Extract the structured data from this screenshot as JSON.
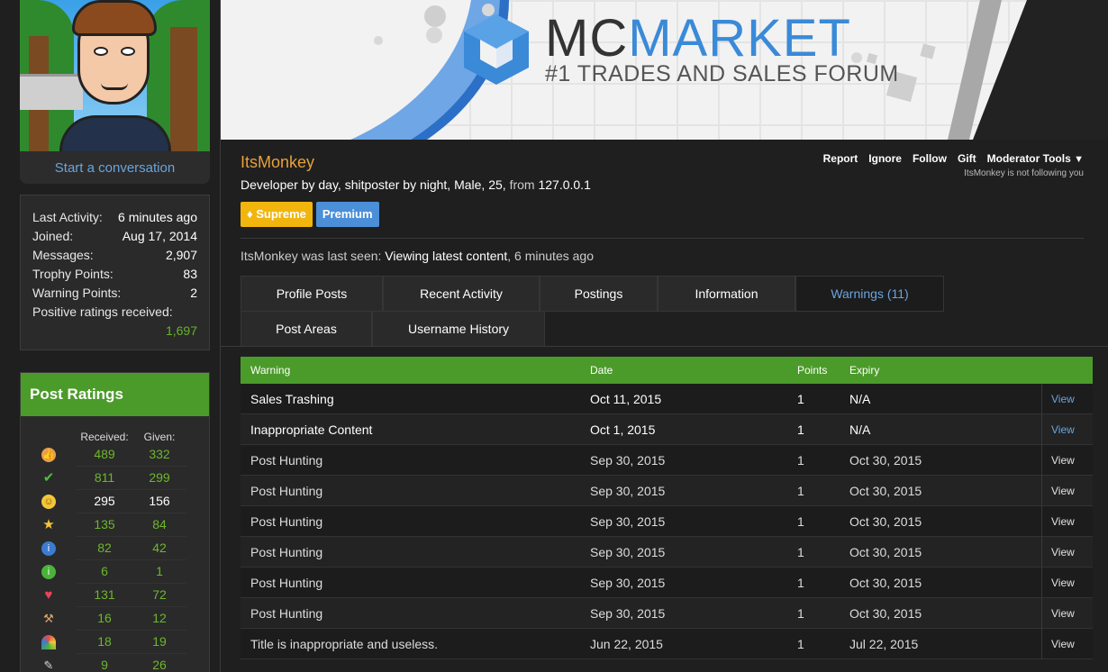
{
  "sidebar": {
    "start_conversation": "Start a conversation",
    "stats": [
      {
        "label": "Last Activity:",
        "value": "6 minutes ago"
      },
      {
        "label": "Joined:",
        "value": "Aug 17, 2014"
      },
      {
        "label": "Messages:",
        "value": "2,907"
      },
      {
        "label": "Trophy Points:",
        "value": "83"
      },
      {
        "label": "Warning Points:",
        "value": "2"
      }
    ],
    "positive_label": "Positive ratings received:",
    "positive_value": "1,697",
    "ratings": {
      "title": "Post Ratings",
      "received_label": "Received:",
      "given_label": "Given:",
      "rows": [
        {
          "icon": "thumbs-up-icon",
          "received": "489",
          "given": "332"
        },
        {
          "icon": "checkmark-icon",
          "received": "811",
          "given": "299"
        },
        {
          "icon": "smiley-icon",
          "received": "295",
          "given": "156"
        },
        {
          "icon": "star-icon",
          "received": "135",
          "given": "84"
        },
        {
          "icon": "info-icon",
          "received": "82",
          "given": "42"
        },
        {
          "icon": "green-info-icon",
          "received": "6",
          "given": "1"
        },
        {
          "icon": "heart-icon",
          "received": "131",
          "given": "72"
        },
        {
          "icon": "wrench-icon",
          "received": "16",
          "given": "12"
        },
        {
          "icon": "rainbow-icon",
          "received": "18",
          "given": "19"
        },
        {
          "icon": "paintbrush-icon",
          "received": "9",
          "given": "26"
        }
      ]
    }
  },
  "banner": {
    "title_a": "MC",
    "title_b": "MARKET",
    "subtitle": "#1 TRADES AND SALES FORUM"
  },
  "profile": {
    "username": "ItsMonkey",
    "blurb_main": "Developer by day, shitposter by night, Male, 25,",
    "blurb_from": "from",
    "blurb_location": "127.0.0.1",
    "badge_supreme": "Supreme",
    "badge_premium": "Premium",
    "last_seen_prefix": "ItsMonkey was last seen:",
    "last_seen_activity": "Viewing latest content",
    "last_seen_time": ", 6 minutes ago",
    "actions": [
      "Report",
      "Ignore",
      "Follow",
      "Gift",
      "Moderator Tools"
    ],
    "follow_note": "ItsMonkey is not following you"
  },
  "tabs": {
    "row1": [
      "Profile Posts",
      "Recent Activity",
      "Postings",
      "Information",
      "Warnings (11)"
    ],
    "row2": [
      "Post Areas",
      "Username History"
    ]
  },
  "warnings": {
    "headers": [
      "Warning",
      "Date",
      "Points",
      "Expiry"
    ],
    "view_label": "View",
    "rows": [
      {
        "warning": "Sales Trashing",
        "date": "Oct 11, 2015",
        "points": "1",
        "expiry": "N/A"
      },
      {
        "warning": "Inappropriate Content",
        "date": "Oct 1, 2015",
        "points": "1",
        "expiry": "N/A"
      },
      {
        "warning": "Post Hunting",
        "date": "Sep 30, 2015",
        "points": "1",
        "expiry": "Oct 30, 2015"
      },
      {
        "warning": "Post Hunting",
        "date": "Sep 30, 2015",
        "points": "1",
        "expiry": "Oct 30, 2015"
      },
      {
        "warning": "Post Hunting",
        "date": "Sep 30, 2015",
        "points": "1",
        "expiry": "Oct 30, 2015"
      },
      {
        "warning": "Post Hunting",
        "date": "Sep 30, 2015",
        "points": "1",
        "expiry": "Oct 30, 2015"
      },
      {
        "warning": "Post Hunting",
        "date": "Sep 30, 2015",
        "points": "1",
        "expiry": "Oct 30, 2015"
      },
      {
        "warning": "Post Hunting",
        "date": "Sep 30, 2015",
        "points": "1",
        "expiry": "Oct 30, 2015"
      },
      {
        "warning": "Title is inappropriate and useless.",
        "date": "Jun 22, 2015",
        "points": "1",
        "expiry": "Jul 22, 2015"
      }
    ]
  },
  "colors": {
    "green": "#4b9b2a",
    "blue_link": "#6aa4dd",
    "gold": "#e6a23a"
  }
}
